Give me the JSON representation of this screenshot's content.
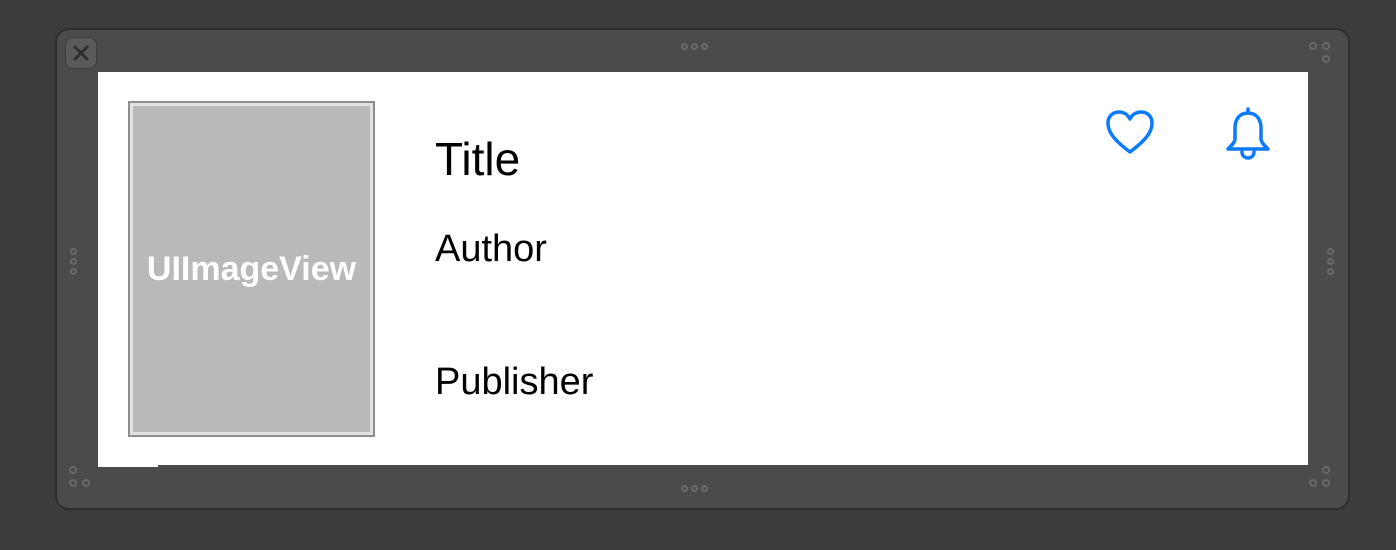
{
  "image_view": {
    "label": "UIImageView"
  },
  "labels": {
    "title": "Title",
    "author": "Author",
    "publisher": "Publisher"
  },
  "icons": {
    "favorite": "heart-icon",
    "notify": "bell-icon",
    "close": "close-icon"
  },
  "colors": {
    "accent": "#0a7aff",
    "canvas_background": "#3c3c3c",
    "frame_background": "#4b4b4b",
    "cell_background": "#ffffff",
    "image_placeholder": "#b9b9b9"
  }
}
